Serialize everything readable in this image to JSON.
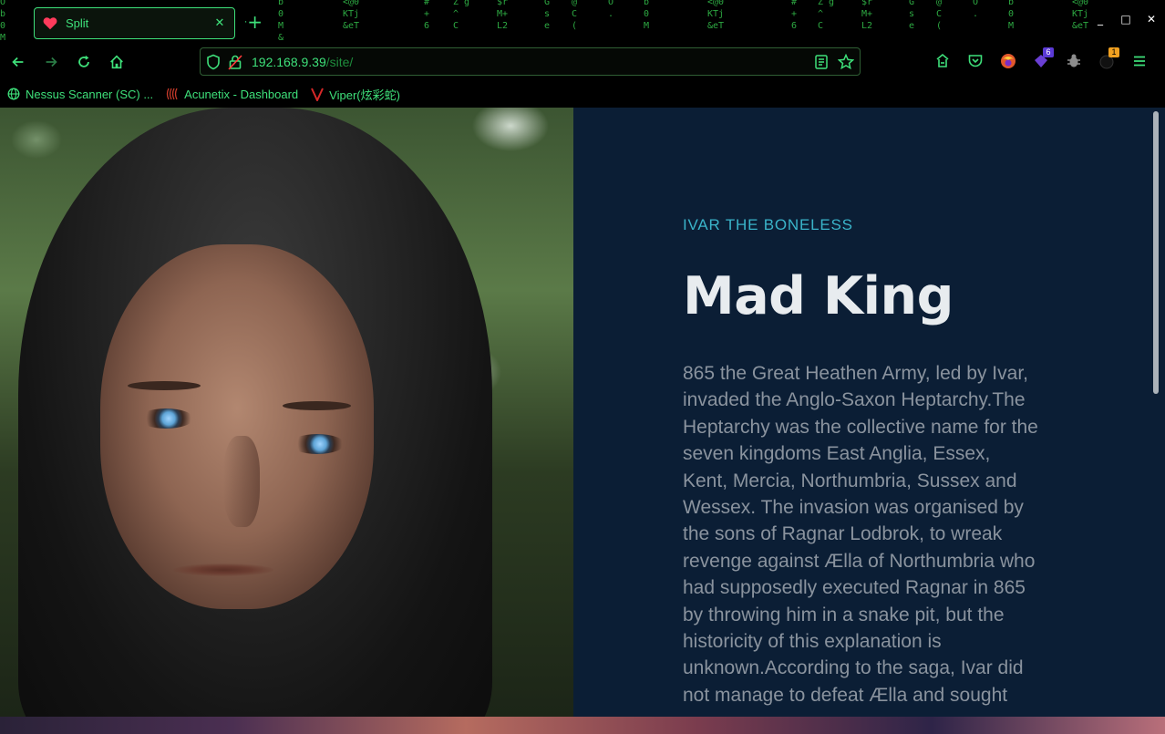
{
  "tab": {
    "title": "Split",
    "close_glyph": "✕",
    "new_tab_glyph": "+"
  },
  "matrix_columns": [
    "O\nb\n0\nM\n&",
    "b\n0\nM\n&",
    "<@0\nKTj\n&eT",
    "#\n+\n6",
    "Z g\n^\nC",
    "$r\nM+\nL2",
    "G\ns\ne",
    "@\nC\n(",
    "O\n.",
    "b\n0\nM",
    "<@0\nKTj\n&eT",
    "#\n+\n6",
    "Z g\n^\nC",
    "$r\nM+\nL2",
    "G\ns\ne",
    "@\nC\n(",
    "O\n.",
    "b\n0\nM",
    "<@0\nKTj\n&eT"
  ],
  "window_controls": [
    "_",
    "□",
    "✕"
  ],
  "nav": {
    "url_host": "192.168.9.39",
    "url_path": "/site/"
  },
  "toolbar_badges": {
    "extension_count": "6",
    "notification_count": "1"
  },
  "bookmarks": [
    {
      "label": "Nessus Scanner (SC) ...",
      "icon": "globe-icon"
    },
    {
      "label": "Acunetix - Dashboard",
      "icon": "acunetix-icon"
    },
    {
      "label": "Viper(炫彩蛇)",
      "icon": "viper-icon"
    }
  ],
  "content": {
    "subtitle": "IVAR THE BONELESS",
    "headline": "Mad King",
    "body": "865 the Great Heathen Army, led by Ivar, invaded the Anglo-Saxon Heptarchy.The Heptarchy was the collective name for the seven kingdoms East Anglia, Essex, Kent, Mercia, Northumbria, Sussex and Wessex. The invasion was organised by the sons of Ragnar Lodbrok, to wreak revenge against Ælla of Northumbria who had supposedly executed Ragnar in 865 by throwing him in a snake pit, but the historicity of this explanation is unknown.According to the saga, Ivar did not manage to defeat Ælla and sought"
  },
  "colors": {
    "accent_green": "#3ee07a",
    "panel_bg": "#0b1e35",
    "subtitle_color": "#3ab4c9",
    "headline_color": "#e8ecef",
    "body_color": "#8a939e"
  }
}
